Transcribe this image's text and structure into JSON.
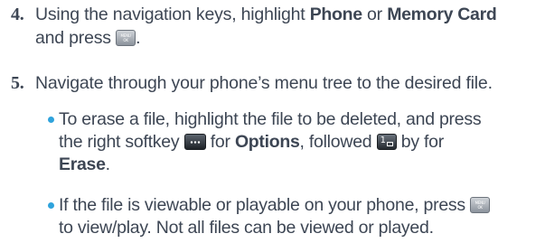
{
  "steps": [
    {
      "number": "4.",
      "line1_pre": "Using the navigation keys, highlight ",
      "bold1": "Phone",
      "mid": " or ",
      "bold2": "Memory Card",
      "line2_pre": "and press",
      "line2_post": ".",
      "key_icon": "menu-ok-key-icon"
    },
    {
      "number": "5.",
      "text": "Navigate through your phone’s menu tree to the desired file."
    }
  ],
  "bullets": [
    {
      "line1": "To erase a file, highlight the file to be deleted, and press",
      "line2_pre": "the right softkey",
      "line2_mid1": "for",
      "bold_options": "Options",
      "line2_mid2": ", followed",
      "line2_post": "by for",
      "bold_erase": "Erase",
      "line3_post": ".",
      "softkey_icon": "right-softkey-icon",
      "number_key_icon": "key-1-icon"
    },
    {
      "line1": "If the file is viewable or playable on your phone, press",
      "line2": "to view/play. Not all files can be viewed or played.",
      "key_icon": "menu-ok-key-icon"
    }
  ],
  "key_labels": {
    "menu_top": "MENU",
    "menu_bottom": "OK",
    "number_key": "1"
  },
  "colors": {
    "text": "#3d4654",
    "bullet": "#2fa3dc"
  }
}
